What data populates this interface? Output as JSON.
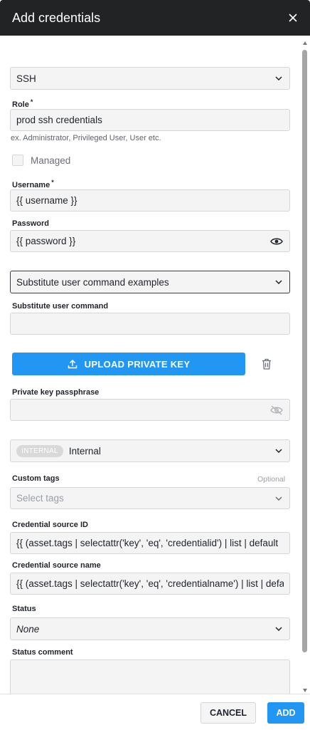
{
  "dialog": {
    "title": "Add credentials"
  },
  "type_select": {
    "value": "SSH"
  },
  "role": {
    "label": "Role",
    "required_mark": "*",
    "value": "prod ssh credentials",
    "hint": "ex. Administrator, Privileged User, User etc."
  },
  "managed": {
    "label": "Managed",
    "checked": false
  },
  "username": {
    "label": "Username",
    "required_mark": "*",
    "value": "{{ username }}"
  },
  "password": {
    "label": "Password",
    "value": "{{ password }}"
  },
  "su_examples": {
    "value": "Substitute user command examples"
  },
  "su_command": {
    "label": "Substitute user command",
    "value": ""
  },
  "upload": {
    "label": "UPLOAD PRIVATE KEY"
  },
  "passphrase": {
    "label": "Private key passphrase",
    "value": ""
  },
  "vault": {
    "badge": "INTERNAL",
    "value": "Internal"
  },
  "custom_tags": {
    "label": "Custom tags",
    "optional": "Optional",
    "placeholder": "Select tags"
  },
  "source_id": {
    "label": "Credential source ID",
    "value": "{{ (asset.tags | selectattr('key', 'eq', 'credentialid') | list | default"
  },
  "source_name": {
    "label": "Credential source name",
    "value": "{{ (asset.tags | selectattr('key', 'eq', 'credentialname') | list | default"
  },
  "status": {
    "label": "Status",
    "value": "None"
  },
  "status_comment": {
    "label": "Status comment",
    "value": ""
  },
  "footer": {
    "cancel": "CANCEL",
    "add": "ADD"
  },
  "colors": {
    "header": "#222325",
    "primary": "#2196f3",
    "field_bg": "#f4f4f5"
  }
}
